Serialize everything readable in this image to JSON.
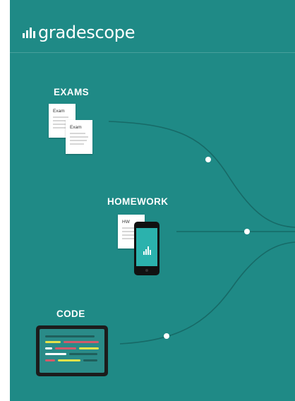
{
  "brand": {
    "logo": "gradescope"
  },
  "sections": {
    "exams": {
      "heading": "EXAMS",
      "paper_label": "Exam"
    },
    "homework": {
      "heading": "HOMEWORK",
      "paper_label": "HW"
    },
    "code": {
      "heading": "CODE"
    }
  },
  "colors": {
    "background": "#1f8a86",
    "line": "#176a67",
    "code_yellow": "#e5e24a",
    "code_red": "#d45a6a",
    "code_white": "#ffffff",
    "code_dark": "#1f5f5c"
  }
}
